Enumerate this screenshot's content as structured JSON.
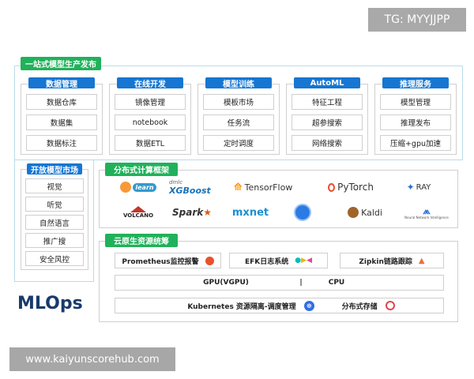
{
  "watermark_top": "TG: MYYJJPP",
  "watermark_bottom": "www.kaiyunscorehub.com",
  "brand": "MLOps",
  "one_stop": {
    "tag": "一站式模型生产发布",
    "columns": [
      {
        "title": "数据管理",
        "items": [
          "数据仓库",
          "数据集",
          "数据标注"
        ]
      },
      {
        "title": "在线开发",
        "items": [
          "镜像管理",
          "notebook",
          "数据ETL"
        ]
      },
      {
        "title": "模型训练",
        "items": [
          "模板市场",
          "任务流",
          "定时调度"
        ]
      },
      {
        "title": "AutoML",
        "items": [
          "特征工程",
          "超参搜索",
          "网络搜索"
        ]
      },
      {
        "title": "推理服务",
        "items": [
          "模型管理",
          "推理发布",
          "压缩+gpu加速"
        ]
      }
    ]
  },
  "model_market": {
    "title": "开放模型市场",
    "items": [
      "视觉",
      "听觉",
      "自然语言",
      "推广搜",
      "安全风控"
    ]
  },
  "distributed": {
    "tag": "分布式计算框架",
    "row1": [
      "learn",
      "XGBoost",
      "TensorFlow",
      "PyTorch",
      "RAY"
    ],
    "row1_sub": {
      "XGBoost": "dmlc"
    },
    "row2": [
      "VOLCANO",
      "Spark",
      "mxnet",
      "",
      "Kaldi",
      "Neural Network Intelligence"
    ],
    "colors": {
      "tf": "#ff8f00",
      "pytorch": "#ee4c2c",
      "ray": "#2a6fd6",
      "mxnet": "#1c8fd0",
      "spark": "#e25a1c"
    }
  },
  "cloud": {
    "tag": "云原生资源统筹",
    "monitor": "Prometheus监控报警",
    "efk": "EFK日志系统",
    "zipkin": "Zipkin链路跟踪",
    "gpu": "GPU(VGPU)",
    "divider": "|",
    "cpu": "CPU",
    "k8s": "Kubernetes 资源隔离-调度管理",
    "storage": "分布式存储"
  },
  "colors": {
    "green": "#21b15a",
    "blue": "#1676d2",
    "frame": "#b9dcea",
    "brand": "#1a3a6b"
  }
}
